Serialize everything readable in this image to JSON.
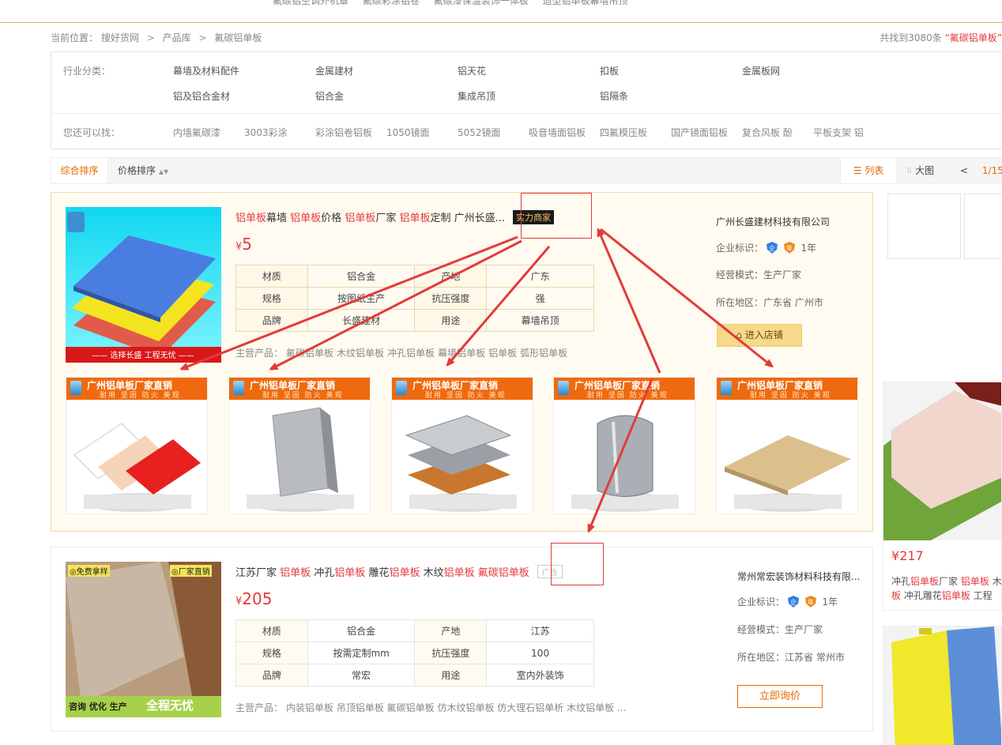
{
  "top_words": [
    "氟碳铝空调外机罩",
    "氟碳彩涂铝卷",
    "氟碳漆保温装饰一体板",
    "造型铝单板幕墙吊顶"
  ],
  "breadcrumb": {
    "prefix": "当前位置：",
    "items": [
      "搜好货网",
      "产品库",
      "氟碳铝单板"
    ],
    "sep": ">"
  },
  "total": {
    "prefix": "共找到3080条",
    "keyword": "“氟碳铝单板”"
  },
  "filter": {
    "industry_label": "行业分类：",
    "industry_items": [
      "幕墙及材料配件",
      "金属建材",
      "铝天花",
      "扣板",
      "金属板网",
      "铝及铝合金材",
      "铝合金",
      "集成吊顶",
      "铝隔条"
    ],
    "also_label": "您还可以找：",
    "also_items": [
      "内墙氟碳漆",
      "3003彩涂",
      "彩涂铝卷铝板",
      "1050镜面",
      "5052镜面",
      "吸音墙面铝板",
      "四氟模压板",
      "国产镜面铝板",
      "复合风板 酚",
      "平板支架 铝"
    ]
  },
  "sortbar": {
    "general": "综合排序",
    "price": "价格排序",
    "list": "列表",
    "grid": "大图",
    "prev": "<",
    "page": "1/15"
  },
  "card1": {
    "title_parts": [
      {
        "t": "铝单板",
        "hl": true
      },
      {
        "t": "幕墙 ",
        "hl": false
      },
      {
        "t": "铝单板",
        "hl": true
      },
      {
        "t": "价格 ",
        "hl": false
      },
      {
        "t": "铝单板",
        "hl": true
      },
      {
        "t": "厂家 ",
        "hl": false
      },
      {
        "t": "铝单板",
        "hl": true
      },
      {
        "t": "定制 广州长盛...",
        "hl": false
      }
    ],
    "badge": "实力商家",
    "currency": "¥",
    "price": "5",
    "attrs": [
      [
        "材质",
        "铝合金",
        "产地",
        "广东"
      ],
      [
        "规格",
        "按图纸生产",
        "抗压强度",
        "强"
      ],
      [
        "品牌",
        "长盛建材",
        "用途",
        "幕墙吊顶"
      ]
    ],
    "main_label": "主营产品：",
    "main_items": [
      "氟碳铝单板",
      "木纹铝单板",
      "冲孔铝单板",
      "幕墙铝单板",
      "铝单板",
      "弧形铝单板"
    ],
    "company": "广州长盛建材科技有限公司",
    "cert_label": "企业标识：",
    "years": "1年",
    "mode": "经营模式：生产厂家",
    "region": "所在地区：广东省 广州市",
    "button": "进入店铺",
    "thumb_banner": "广州铝单板厂家直销",
    "thumb_sub": "耐用 坚固 防火 美观"
  },
  "card2": {
    "title_parts": [
      {
        "t": "江苏厂家 ",
        "hl": false
      },
      {
        "t": "铝单板",
        "hl": true
      },
      {
        "t": " 冲孔",
        "hl": false
      },
      {
        "t": "铝单板",
        "hl": true
      },
      {
        "t": " 雕花",
        "hl": false
      },
      {
        "t": "铝单板",
        "hl": true
      },
      {
        "t": " 木纹",
        "hl": false
      },
      {
        "t": "铝单板",
        "hl": true
      },
      {
        "t": " ",
        "hl": false
      },
      {
        "t": "氟碳铝单板",
        "hl": true
      }
    ],
    "badge": "广告",
    "currency": "¥",
    "price": "205",
    "attrs": [
      [
        "材质",
        "铝合金",
        "产地",
        "江苏"
      ],
      [
        "规格",
        "按需定制mm",
        "抗压强度",
        "100"
      ],
      [
        "品牌",
        "常宏",
        "用途",
        "室内外装饰"
      ]
    ],
    "main_label": "主营产品：",
    "main_text": "内装铝单板 吊顶铝单板 氟碳铝单板 仿木纹铝单板 仿大理石铝单析 木纹铝单板 ...",
    "img_tag_left": "◎免费拿样",
    "img_tag_right": "◎厂家直销",
    "img_bottom_left": "咨询 优化 生产",
    "img_bottom_right": "全程无忧",
    "company": "常州常宏装饰材料科技有限...",
    "cert_label": "企业标识：",
    "years": "1年",
    "mode": "经营模式：生产厂家",
    "region": "所在地区：江苏省 常州市",
    "button": "立即询价"
  },
  "right_ad": {
    "currency": "¥",
    "price": "217",
    "title_line1_parts": [
      {
        "t": "冲孔",
        "hl": false
      },
      {
        "t": "铝单板",
        "hl": true
      },
      {
        "t": "厂家 ",
        "hl": false
      },
      {
        "t": "铝单板",
        "hl": true
      },
      {
        "t": " 木",
        "hl": false
      }
    ],
    "title_line2_parts": [
      {
        "t": "板",
        "hl": true
      },
      {
        "t": " 冲孔雕花",
        "hl": false
      },
      {
        "t": "铝单板",
        "hl": true
      },
      {
        "t": " 工程",
        "hl": false
      }
    ]
  },
  "colors": {
    "accent": "#e56b00",
    "highlight": "#e4393c",
    "annotation": "#e23b3b"
  }
}
